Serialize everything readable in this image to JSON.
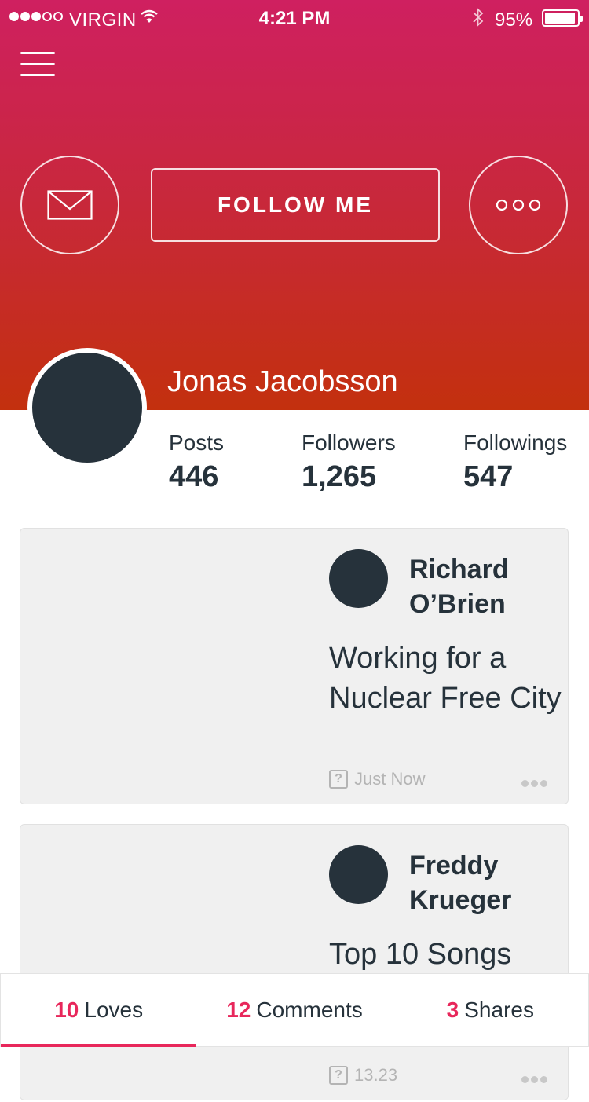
{
  "status_bar": {
    "carrier": "VIRGIN",
    "time": "4:21 PM",
    "battery": "95%",
    "battery_level": 0.95,
    "signal_bars_filled": 3,
    "signal_bars_total": 5
  },
  "header": {
    "follow_label": "FOLLOW ME"
  },
  "profile": {
    "name": "Jonas Jacobsson",
    "stats": {
      "posts_label": "Posts",
      "posts_value": "446",
      "followers_label": "Followers",
      "followers_value": "1,265",
      "followings_label": "Followings",
      "followings_value": "547"
    }
  },
  "posts": [
    {
      "author": "Richard O’Brien",
      "text": "Working for a Nuclear Free City",
      "time": "Just Now"
    },
    {
      "author": "Freddy Krueger",
      "text": "Top 10 Songs",
      "time": "13.23"
    }
  ],
  "tabs": [
    {
      "count": "10",
      "label": "Loves"
    },
    {
      "count": "12",
      "label": "Comments"
    },
    {
      "count": "3",
      "label": "Shares"
    }
  ],
  "colors": {
    "accent": "#e8275b",
    "header_top": "#cf2060",
    "header_bottom": "#c3300e",
    "dark": "#26323b"
  }
}
